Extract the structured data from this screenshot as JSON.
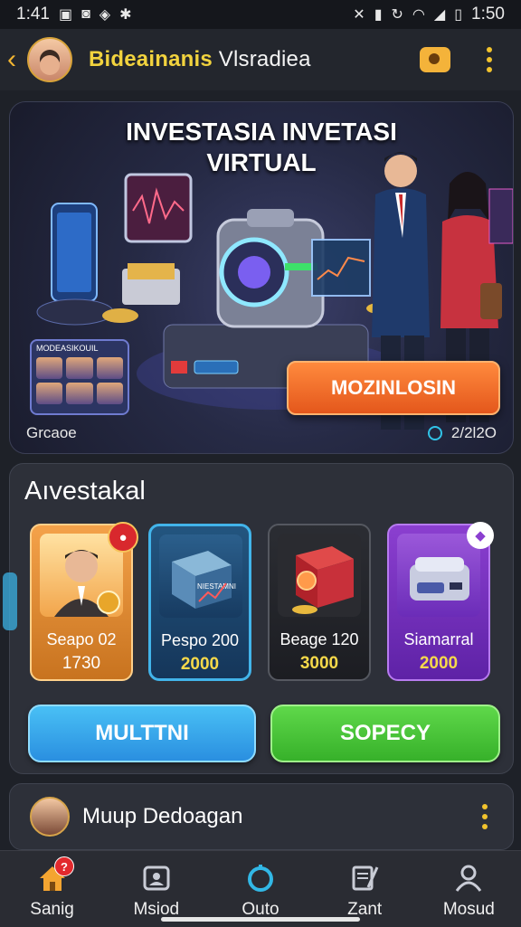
{
  "status_bar": {
    "time_left": "1:41",
    "time_right": "1:50"
  },
  "header": {
    "back_icon": "chevron-left-icon",
    "title_part1": "Bideainanis",
    "title_part2": "Vlsradiea"
  },
  "hero": {
    "title_line1": "INVESTASIA INVETASI",
    "title_line2": "VIRTUAL",
    "cta_label": "MOZINLOSIN",
    "footer_left": "Grcaoe",
    "footer_right": "2/2l2O",
    "mini_panel_title": "MODEASIKOUIL"
  },
  "investments": {
    "title": "Aıvestakal",
    "cards": [
      {
        "name": "Seapo 02",
        "price": "1730",
        "badge": ""
      },
      {
        "name": "Pespo 200",
        "price": "2000",
        "img_text": "NIESTAMNI"
      },
      {
        "name": "Beage 120",
        "price": "3000"
      },
      {
        "name": "Siamarral",
        "price": "2000"
      }
    ],
    "buttons": {
      "left_label": "MULTTNI",
      "right_label": "SOPECY"
    }
  },
  "friend_row": {
    "name": "Muup Dedoagan"
  },
  "bottom_nav": [
    {
      "label": "Sanig",
      "icon": "home-icon",
      "badge": "?"
    },
    {
      "label": "Msiod",
      "icon": "profile-card-icon"
    },
    {
      "label": "Outo",
      "icon": "ring-icon"
    },
    {
      "label": "Zant",
      "icon": "edit-document-icon"
    },
    {
      "label": "Mosud",
      "icon": "user-icon"
    }
  ],
  "colors": {
    "accent_gold": "#f2d33e",
    "cta_orange": "#ff8a3d",
    "blue_button": "#49c0f5",
    "green_button": "#5fd84a"
  }
}
